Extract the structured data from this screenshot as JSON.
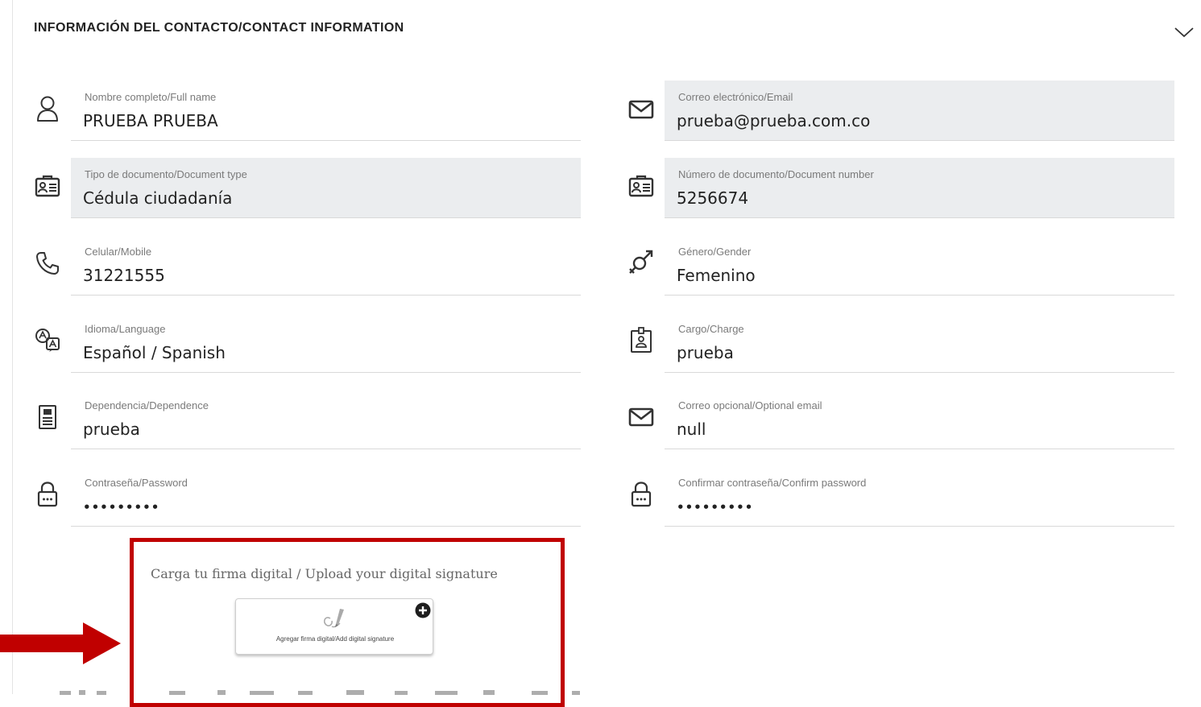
{
  "section": {
    "title": "INFORMACIÓN DEL CONTACTO/CONTACT INFORMATION"
  },
  "fields": {
    "full_name": {
      "label": "Nombre completo/Full name",
      "value": "PRUEBA PRUEBA",
      "icon": "person-icon"
    },
    "email": {
      "label": "Correo electrónico/Email",
      "value": "prueba@prueba.com.co",
      "icon": "mail-icon"
    },
    "document_type": {
      "label": "Tipo de documento/Document type",
      "value": "Cédula ciudadanía",
      "icon": "id-card-icon"
    },
    "document_number": {
      "label": "Número de documento/Document number",
      "value": "5256674",
      "icon": "id-card-icon"
    },
    "mobile": {
      "label": "Celular/Mobile",
      "value": "31221555",
      "icon": "phone-icon"
    },
    "gender": {
      "label": "Género/Gender",
      "value": "Femenino",
      "icon": "gender-icon"
    },
    "language": {
      "label": "Idioma/Language",
      "value": "Español / Spanish",
      "icon": "translate-icon"
    },
    "charge": {
      "label": "Cargo/Charge",
      "value": "prueba",
      "icon": "badge-icon"
    },
    "dependence": {
      "label": "Dependencia/Dependence",
      "value": "prueba",
      "icon": "document-icon"
    },
    "optional_email": {
      "label": "Correo opcional/Optional email",
      "value": "null",
      "icon": "mail-icon"
    },
    "password": {
      "label": "Contraseña/Password",
      "value": "•••••••••",
      "icon": "lock-icon"
    },
    "confirm_password": {
      "label": "Confirmar contraseña/Confirm password",
      "value": "•••••••••",
      "icon": "lock-icon"
    }
  },
  "signature": {
    "label": "Carga tu firma digital / Upload your digital signature",
    "button_caption": "Agregar firma digital/Add digital signature"
  },
  "colors": {
    "highlight": "#c00000",
    "readonly_bg": "#ebedef",
    "label": "#7a7a7a"
  }
}
